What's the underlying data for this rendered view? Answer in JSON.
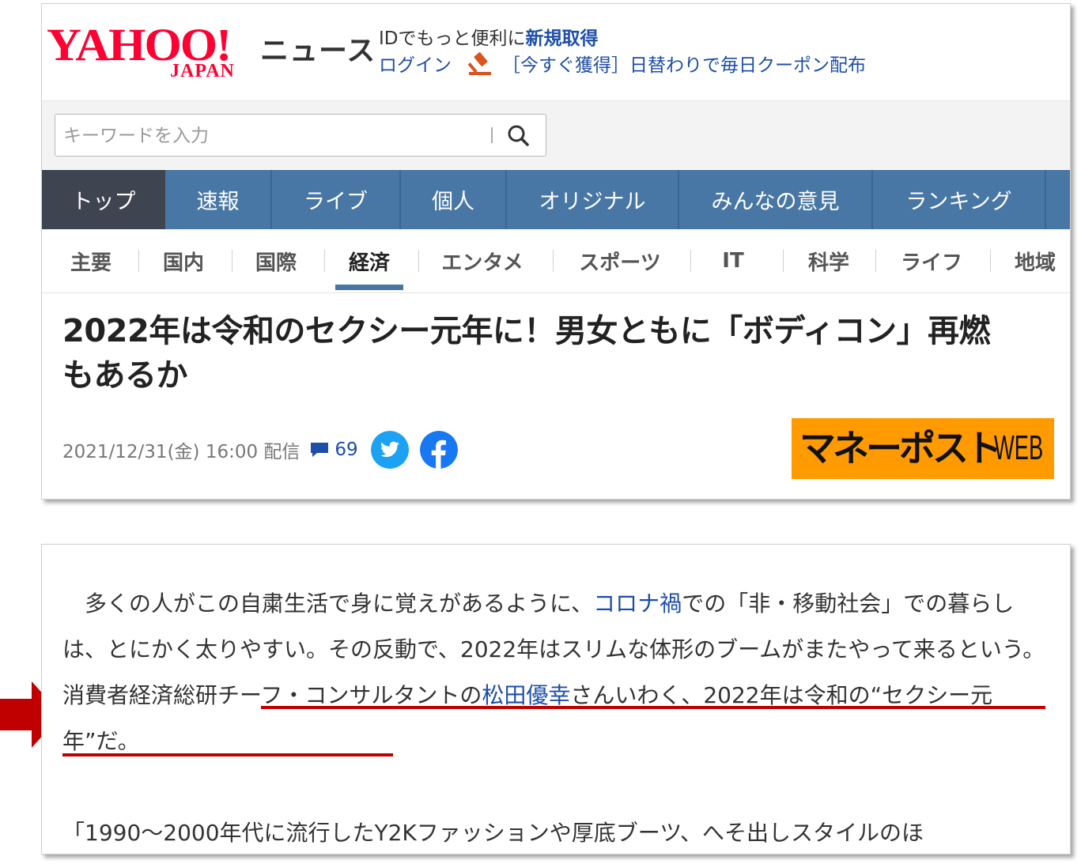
{
  "header": {
    "logo_text": "YAHOO!",
    "logo_sub": "JAPAN",
    "section": "ニュース",
    "id_prefix": "IDでもっと便利に",
    "id_link": "新規取得",
    "login": "ログイン",
    "promo": "［今すぐ獲得］日替わりで毎日クーポン配布"
  },
  "search": {
    "placeholder": "キーワードを入力"
  },
  "main_nav": [
    "トップ",
    "速報",
    "ライブ",
    "個人",
    "オリジナル",
    "みんなの意見",
    "ランキング"
  ],
  "sub_nav": [
    "主要",
    "国内",
    "国際",
    "経済",
    "エンタメ",
    "スポーツ",
    "IT",
    "科学",
    "ライフ",
    "地域"
  ],
  "sub_nav_active": "経済",
  "article": {
    "title_line1": "2022年は令和のセクシー元年に！男女ともに「ボディコン」再燃",
    "title_line2": "もあるか",
    "datetime": "2021/12/31(金) 16:00 配信",
    "comment_count": "69",
    "source_brand_main": "マネーポスト",
    "source_brand_suffix": "WEB"
  },
  "body": {
    "p1_a": "　多くの人がこの自粛生活で身に覚えがあるように、",
    "p1_link": "コロナ禍",
    "p1_b": "での「非・移動社会」での暮らしは、とにかく太りやすい。その反動で、2022年はスリムな体形のブームがまたやって来るという。消費者経済総研チーフ・コンサルタントの",
    "p1_link2": "松田優幸",
    "p1_c": "さんいわく、2022年は令和の“セクシー元年”だ。",
    "p2": "「1990～2000年代に流行したY2Kファッションや厚底ブーツ、へそ出しスタイルのほ"
  },
  "colors": {
    "yahoo_red": "#ff0033",
    "nav_blue": "#4977a5",
    "nav_active": "#3e4551",
    "link_blue": "#1d4ea8",
    "brand_orange": "#ff9a00",
    "annotation_red": "#c00000",
    "twitter": "#1da1f2",
    "facebook": "#1877f2"
  }
}
